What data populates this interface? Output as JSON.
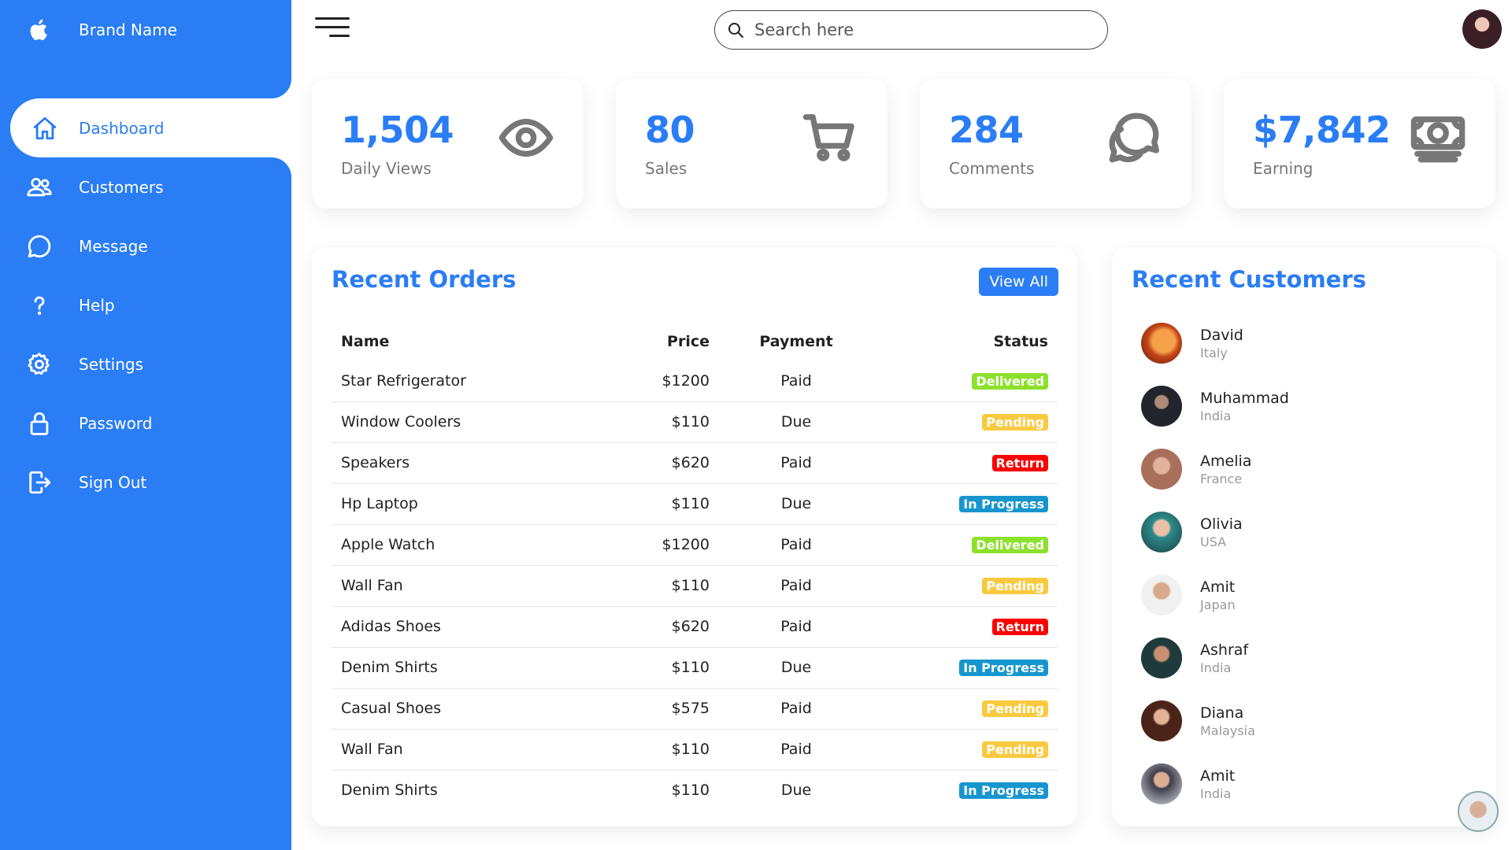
{
  "brand": {
    "name": "Brand Name",
    "icon": "apple-icon"
  },
  "nav": [
    {
      "label": "Dashboard",
      "icon": "home-icon",
      "active": true
    },
    {
      "label": "Customers",
      "icon": "people-icon"
    },
    {
      "label": "Message",
      "icon": "chat-icon"
    },
    {
      "label": "Help",
      "icon": "help-icon"
    },
    {
      "label": "Settings",
      "icon": "gear-icon"
    },
    {
      "label": "Password",
      "icon": "lock-icon"
    },
    {
      "label": "Sign Out",
      "icon": "sign-out-icon"
    }
  ],
  "search": {
    "placeholder": "Search here"
  },
  "cards": [
    {
      "number": "1,504",
      "name": "Daily Views",
      "icon": "eye-icon"
    },
    {
      "number": "80",
      "name": "Sales",
      "icon": "cart-icon"
    },
    {
      "number": "284",
      "name": "Comments",
      "icon": "chatbubbles-icon"
    },
    {
      "number": "$7,842",
      "name": "Earning",
      "icon": "cash-icon"
    }
  ],
  "orders": {
    "title": "Recent Orders",
    "view_all": "View All",
    "headers": {
      "name": "Name",
      "price": "Price",
      "payment": "Payment",
      "status": "Status"
    },
    "rows": [
      {
        "name": "Star Refrigerator",
        "price": "$1200",
        "payment": "Paid",
        "status": "Delivered"
      },
      {
        "name": "Window Coolers",
        "price": "$110",
        "payment": "Due",
        "status": "Pending"
      },
      {
        "name": "Speakers",
        "price": "$620",
        "payment": "Paid",
        "status": "Return"
      },
      {
        "name": "Hp Laptop",
        "price": "$110",
        "payment": "Due",
        "status": "In Progress"
      },
      {
        "name": "Apple Watch",
        "price": "$1200",
        "payment": "Paid",
        "status": "Delivered"
      },
      {
        "name": "Wall Fan",
        "price": "$110",
        "payment": "Paid",
        "status": "Pending"
      },
      {
        "name": "Adidas Shoes",
        "price": "$620",
        "payment": "Paid",
        "status": "Return"
      },
      {
        "name": "Denim Shirts",
        "price": "$110",
        "payment": "Due",
        "status": "In Progress"
      },
      {
        "name": "Casual Shoes",
        "price": "$575",
        "payment": "Paid",
        "status": "Pending"
      },
      {
        "name": "Wall Fan",
        "price": "$110",
        "payment": "Paid",
        "status": "Pending"
      },
      {
        "name": "Denim Shirts",
        "price": "$110",
        "payment": "Due",
        "status": "In Progress"
      }
    ]
  },
  "customers": {
    "title": "Recent Customers",
    "list": [
      {
        "name": "David",
        "country": "Italy"
      },
      {
        "name": "Muhammad",
        "country": "India"
      },
      {
        "name": "Amelia",
        "country": "France"
      },
      {
        "name": "Olivia",
        "country": "USA"
      },
      {
        "name": "Amit",
        "country": "Japan"
      },
      {
        "name": "Ashraf",
        "country": "India"
      },
      {
        "name": "Diana",
        "country": "Malaysia"
      },
      {
        "name": "Amit",
        "country": "India"
      }
    ]
  },
  "colors": {
    "accent": "#2a7df4",
    "delivered": "#8de02c",
    "pending": "#f9ca3f",
    "return": "#ff0000",
    "in_progress": "#1795ce"
  }
}
